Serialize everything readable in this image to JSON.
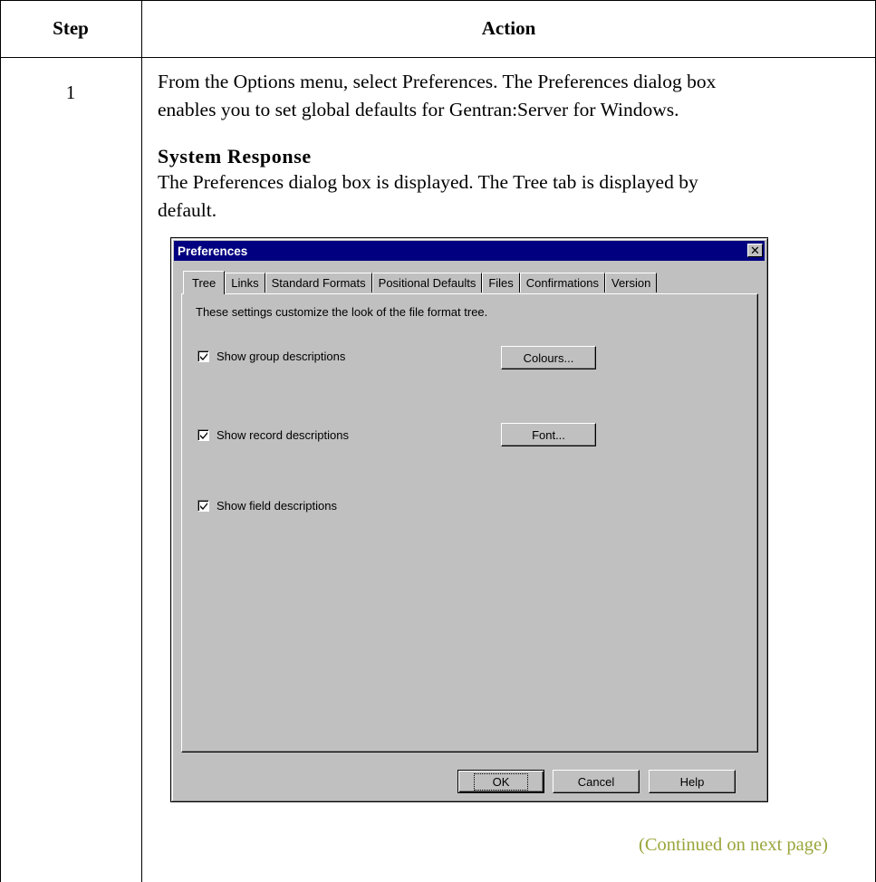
{
  "table": {
    "header_step": "Step",
    "header_action": "Action",
    "step_number": "1",
    "action_line1": "From the Options menu, select Preferences. The Preferences dialog box",
    "action_line2": "enables you to set global defaults for Gentran:Server for Windows.",
    "system_response_heading": "System Response",
    "response_line1": "The Preferences dialog box is displayed. The Tree tab is displayed by",
    "response_line2": "default.",
    "continued": "(Continued on next page)"
  },
  "dialog": {
    "title": "Preferences",
    "close_glyph": "✕",
    "tabs": [
      {
        "label": "Tree"
      },
      {
        "label": "Links"
      },
      {
        "label": "Standard Formats"
      },
      {
        "label": "Positional Defaults"
      },
      {
        "label": "Files"
      },
      {
        "label": "Confirmations"
      },
      {
        "label": "Version"
      }
    ],
    "active_tab": "Tree",
    "description": "These settings customize the look of the file format tree.",
    "checkboxes": [
      {
        "label": "Show group descriptions",
        "checked": true
      },
      {
        "label": "Show record descriptions",
        "checked": true
      },
      {
        "label": "Show field descriptions",
        "checked": true
      }
    ],
    "colours_button": "Colours...",
    "font_button": "Font...",
    "ok_button": "OK",
    "cancel_button": "Cancel",
    "help_button": "Help"
  },
  "colors": {
    "titlebar": "#000080",
    "dialog_face": "#c0c0c0",
    "continued_text": "#9aa53a"
  }
}
